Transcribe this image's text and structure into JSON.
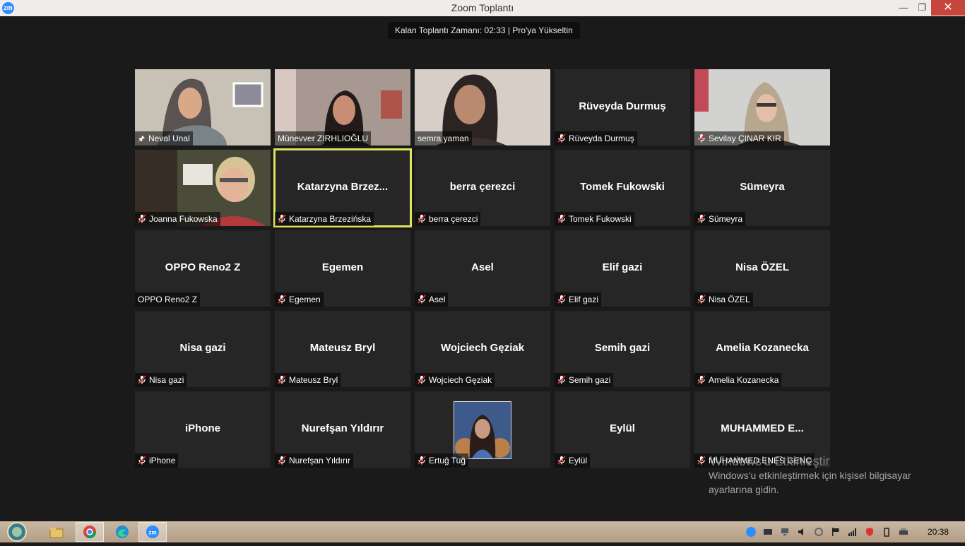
{
  "window": {
    "title": "Zoom Toplantı",
    "app_icon_text": "zm"
  },
  "meeting": {
    "timer_text": "Kalan Toplantı Zamanı: 02:33 | Pro'ya Yükseltin"
  },
  "participants": [
    {
      "label": "Neval Unal",
      "display": "",
      "video": "video-woman-hijab-room",
      "icon": "pin"
    },
    {
      "label": "Münevver ZIRHLIOĞLU",
      "display": "",
      "video": "video-woman-dark-hair",
      "icon": "none"
    },
    {
      "label": "semra yaman",
      "display": "",
      "video": "video-woman-indoor",
      "icon": "none"
    },
    {
      "label": "Rüveyda Durmuş",
      "display": "Rüveyda Durmuş",
      "video": "",
      "icon": "muted"
    },
    {
      "label": "Sevilay ÇINAR KIR",
      "display": "",
      "video": "video-woman-hijab-glasses",
      "icon": "muted"
    },
    {
      "label": "Joanna Fukowska",
      "display": "",
      "video": "video-woman-blonde-glasses",
      "icon": "muted"
    },
    {
      "label": "Katarzyna Brzezińska",
      "display": "Katarzyna  Brzez...",
      "video": "",
      "icon": "muted",
      "active": true
    },
    {
      "label": "berra çerezci",
      "display": "berra çerezci",
      "video": "",
      "icon": "muted"
    },
    {
      "label": "Tomek Fukowski",
      "display": "Tomek Fukowski",
      "video": "",
      "icon": "muted"
    },
    {
      "label": "Sümeyra",
      "display": "Sümeyra",
      "video": "",
      "icon": "muted"
    },
    {
      "label": "OPPO Reno2 Z",
      "display": "OPPO Reno2 Z",
      "video": "",
      "icon": "none"
    },
    {
      "label": "Egemen",
      "display": "Egemen",
      "video": "",
      "icon": "muted"
    },
    {
      "label": "Asel",
      "display": "Asel",
      "video": "",
      "icon": "muted"
    },
    {
      "label": "Elif gazi",
      "display": "Elif gazi",
      "video": "",
      "icon": "muted"
    },
    {
      "label": "Nisa ÖZEL",
      "display": "Nisa ÖZEL",
      "video": "",
      "icon": "muted"
    },
    {
      "label": "Nisa gazi",
      "display": "Nisa gazi",
      "video": "",
      "icon": "muted"
    },
    {
      "label": "Mateusz Bryl",
      "display": "Mateusz Bryl",
      "video": "",
      "icon": "muted"
    },
    {
      "label": "Wojciech Gęziak",
      "display": "Wojciech Gęziak",
      "video": "",
      "icon": "muted"
    },
    {
      "label": "Semih gazi",
      "display": "Semih gazi",
      "video": "",
      "icon": "muted"
    },
    {
      "label": "Amelia Kozanecka",
      "display": "Amelia Kozanecka",
      "video": "",
      "icon": "muted"
    },
    {
      "label": "iPhone",
      "display": "iPhone",
      "video": "",
      "icon": "muted"
    },
    {
      "label": "Nurefşan Yıldırır",
      "display": "Nurefşan Yıldırır",
      "video": "",
      "icon": "muted"
    },
    {
      "label": "Ertuğ Tuğ",
      "display": "",
      "video": "",
      "profile_picture": "profile-picture-doctor-strange",
      "icon": "muted"
    },
    {
      "label": "Eylül",
      "display": "Eylül",
      "video": "",
      "icon": "muted"
    },
    {
      "label": "MUHAMMED ENES GENÇ",
      "display": "MUHAMMED  E...",
      "video": "",
      "icon": "muted"
    }
  ],
  "watermark": {
    "title": "Windows'u Etkinleştir",
    "line1": "Windows'u etkinleştirmek için kişisel bilgisayar",
    "line2": "ayarlarına gidin."
  },
  "taskbar": {
    "items": [
      "start-orb-icon",
      "file-explorer-icon",
      "chrome-icon",
      "edge-icon",
      "zoom-icon"
    ],
    "clock": "20:38"
  },
  "colors": {
    "background": "#1a1a1a",
    "tile": "#262626",
    "active_speaker": "#dde35a",
    "mute_red": "#e02828",
    "zoom_blue": "#2d8cff"
  }
}
